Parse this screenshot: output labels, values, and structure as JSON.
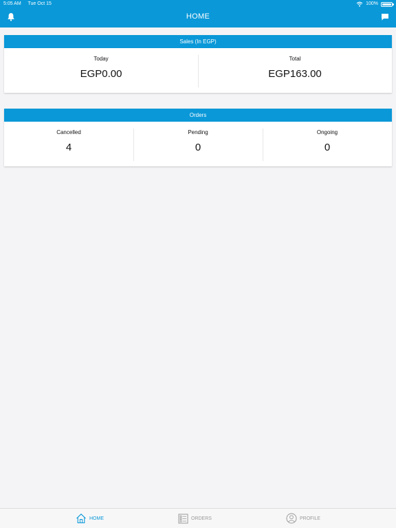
{
  "status": {
    "time": "5:05 AM",
    "date": "Tue Oct 15",
    "battery": "100%"
  },
  "nav": {
    "title": "HOME",
    "left_icon": "bell-icon",
    "right_icon": "chat-icon"
  },
  "sales": {
    "header": "Sales (In EGP)",
    "today_label": "Today",
    "today_value": "EGP0.00",
    "total_label": "Total",
    "total_value": "EGP163.00"
  },
  "orders": {
    "header": "Orders",
    "cancelled_label": "Cancelled",
    "cancelled_value": "4",
    "pending_label": "Pending",
    "pending_value": "0",
    "ongoing_label": "Ongoing",
    "ongoing_value": "0"
  },
  "tabs": {
    "home": "HOME",
    "orders": "ORDERS",
    "profile": "PROFILE"
  },
  "colors": {
    "accent": "#0a98d8",
    "background": "#f4f4f6",
    "inactive_tab": "#9a9a9a"
  }
}
